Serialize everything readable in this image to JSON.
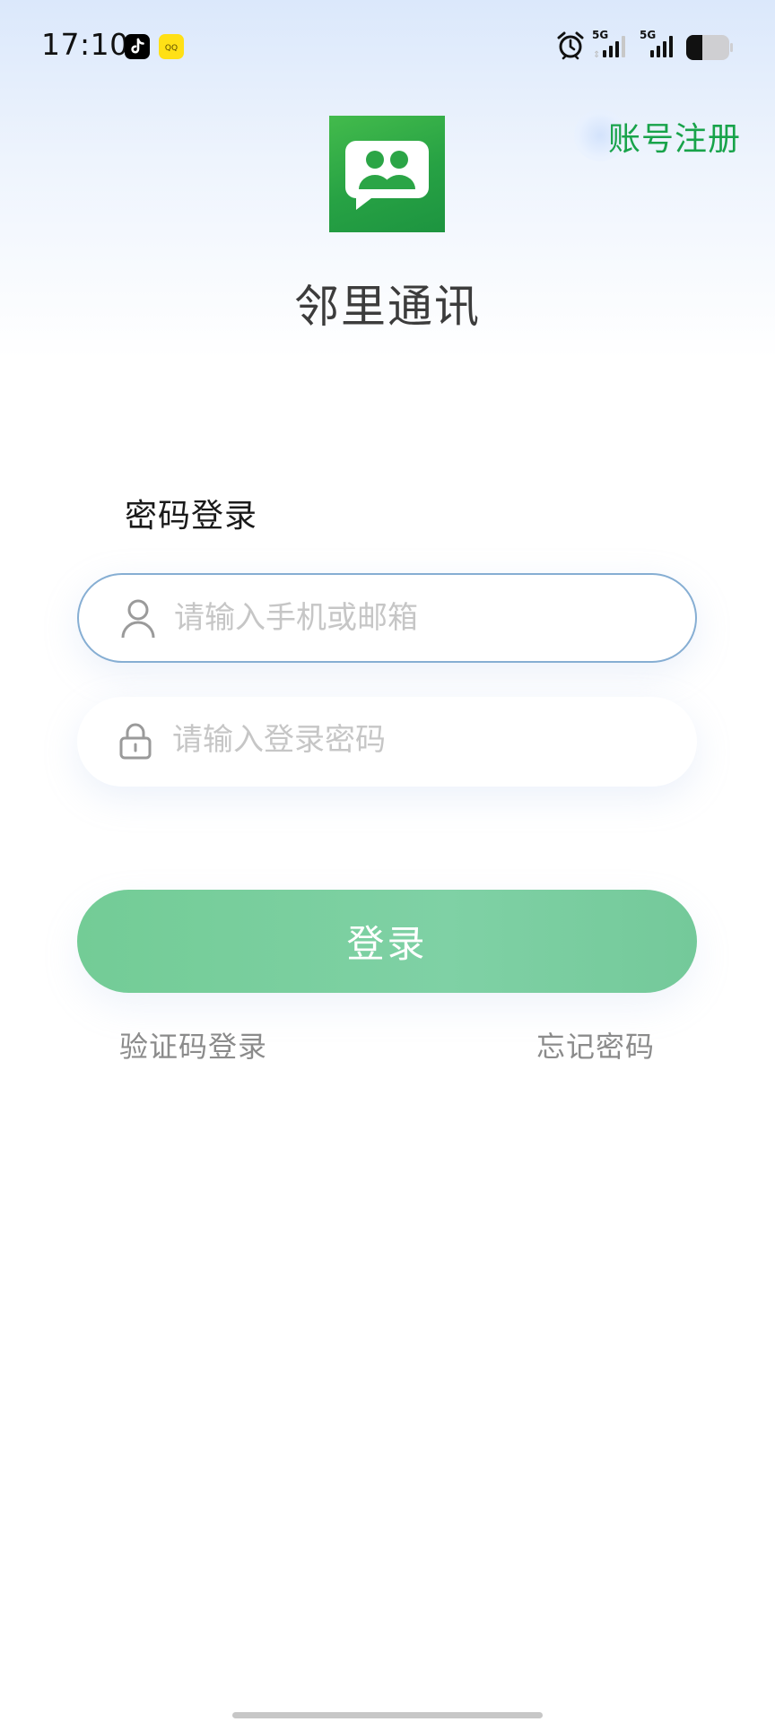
{
  "status_bar": {
    "time": "17:10",
    "icons": [
      "tiktok-icon",
      "qq-music-icon",
      "alarm-icon",
      "5g-signal-icon",
      "5g-signal-icon",
      "battery-icon"
    ],
    "network_labels": [
      "5G",
      "5G"
    ],
    "qq_label": "QQ"
  },
  "header": {
    "register_link": "账号注册"
  },
  "app": {
    "name": "邻里通讯",
    "logo_icon": "chat-people-icon"
  },
  "login": {
    "title": "密码登录",
    "phone_placeholder": "请输入手机或邮箱",
    "phone_icon": "user-icon",
    "password_placeholder": "请输入登录密码",
    "password_icon": "lock-icon",
    "submit_label": "登录",
    "sms_login_link": "验证码登录",
    "forgot_password_link": "忘记密码"
  },
  "colors": {
    "accent_green": "#18a34a",
    "button_green": "#7fd1a5",
    "logo_green": "#2ba546",
    "active_border": "#86aed3"
  }
}
